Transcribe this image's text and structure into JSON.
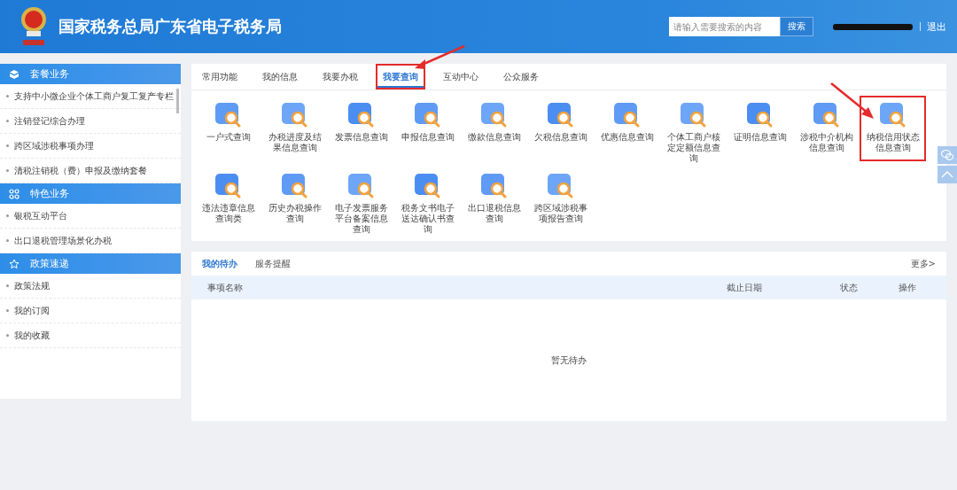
{
  "header": {
    "title": "国家税务总局广东省电子税务局",
    "search": {
      "placeholder": "请输入需要搜索的内容",
      "button": "搜索"
    },
    "logout": "退出"
  },
  "sidebar": [
    {
      "title": "套餐业务",
      "items": [
        "支持中小微企业个体工商户复工复产专栏",
        "注销登记综合办理",
        "跨区域涉税事项办理",
        "清税注销税（费）申报及缴纳套餐"
      ]
    },
    {
      "title": "特色业务",
      "items": [
        "银税互动平台",
        "出口退税管理场景化办税"
      ]
    },
    {
      "title": "政策速递",
      "items": [
        "政策法规",
        "我的订阅",
        "我的收藏"
      ]
    }
  ],
  "tabs": [
    {
      "label": "常用功能",
      "selected": false,
      "highlighted": false
    },
    {
      "label": "我的信息",
      "selected": false,
      "highlighted": false
    },
    {
      "label": "我要办税",
      "selected": false,
      "highlighted": false
    },
    {
      "label": "我要查询",
      "selected": true,
      "highlighted": true
    },
    {
      "label": "互动中心",
      "selected": false,
      "highlighted": false
    },
    {
      "label": "公众服务",
      "selected": false,
      "highlighted": false
    }
  ],
  "functions": [
    {
      "label": "一户式查询",
      "highlighted": false
    },
    {
      "label": "办税进度及结果信息查询",
      "highlighted": false
    },
    {
      "label": "发票信息查询",
      "highlighted": false
    },
    {
      "label": "申报信息查询",
      "highlighted": false
    },
    {
      "label": "缴款信息查询",
      "highlighted": false
    },
    {
      "label": "欠税信息查询",
      "highlighted": false
    },
    {
      "label": "优惠信息查询",
      "highlighted": false
    },
    {
      "label": "个体工商户核定定额信息查询",
      "highlighted": false
    },
    {
      "label": "证明信息查询",
      "highlighted": false
    },
    {
      "label": "涉税中介机构信息查询",
      "highlighted": false
    },
    {
      "label": "纳税信用状态信息查询",
      "highlighted": true
    },
    {
      "label": "违法违章信息查询类",
      "highlighted": false
    },
    {
      "label": "历史办税操作查询",
      "highlighted": false
    },
    {
      "label": "电子发票服务平台备案信息查询",
      "highlighted": false
    },
    {
      "label": "税务文书电子送达确认书查询",
      "highlighted": false
    },
    {
      "label": "出口退税信息查询",
      "highlighted": false
    },
    {
      "label": "跨区域涉税事项报告查询",
      "highlighted": false
    }
  ],
  "todo": {
    "tabs": [
      {
        "label": "我的待办",
        "selected": true
      },
      {
        "label": "服务提醒",
        "selected": false
      }
    ],
    "more": "更多>",
    "columns": [
      "事项名称",
      "截止日期",
      "状态",
      "操作"
    ],
    "empty": "暂无待办"
  }
}
